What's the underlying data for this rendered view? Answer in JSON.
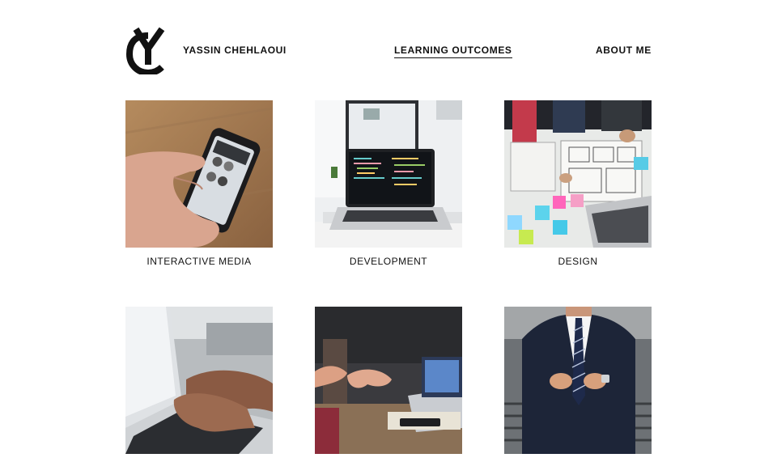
{
  "header": {
    "logo_icon": "yc-monogram-icon",
    "brand_name": "YASSIN CHEHLAOUI",
    "nav": {
      "learning_outcomes": "LEARNING OUTCOMES",
      "about_me": "ABOUT ME"
    }
  },
  "gallery": {
    "cards": [
      {
        "caption": "INTERACTIVE MEDIA",
        "image": "phone-in-hand-photo"
      },
      {
        "caption": "DEVELOPMENT",
        "image": "laptop-code-photo"
      },
      {
        "caption": "DESIGN",
        "image": "wireframe-sketching-photo"
      },
      {
        "caption": "",
        "image": "typing-on-laptop-photo"
      },
      {
        "caption": "",
        "image": "meeting-discussion-photo"
      },
      {
        "caption": "",
        "image": "man-in-suit-photo"
      }
    ]
  }
}
